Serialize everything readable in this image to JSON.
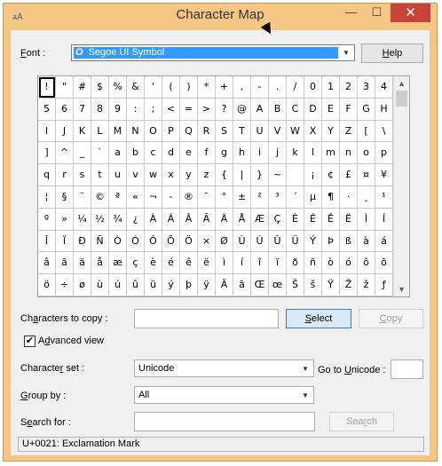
{
  "window": {
    "title": "Character Map",
    "icon": "charmap-app-icon",
    "minimize_glyph": "—",
    "maximize_glyph": "☐",
    "close_glyph": "✕"
  },
  "font": {
    "label_prefix": "",
    "label_key": "F",
    "label_rest": "ont :",
    "selected": "Segoe UI Symbol",
    "font_icon": "opentype-icon"
  },
  "help_button": {
    "key": "H",
    "rest": "elp"
  },
  "grid": {
    "selected_index": 0,
    "characters": [
      "!",
      "\"",
      "#",
      "$",
      "%",
      "&",
      "'",
      "(",
      ")",
      "*",
      "+",
      ",",
      "-",
      ".",
      "/",
      "0",
      "1",
      "2",
      "3",
      "4",
      "5",
      "6",
      "7",
      "8",
      "9",
      ":",
      ";",
      "<",
      "=",
      ">",
      "?",
      "@",
      "A",
      "B",
      "C",
      "D",
      "E",
      "F",
      "G",
      "H",
      "I",
      "J",
      "K",
      "L",
      "M",
      "N",
      "O",
      "P",
      "Q",
      "R",
      "S",
      "T",
      "U",
      "V",
      "W",
      "X",
      "Y",
      "Z",
      "[",
      "\\",
      "]",
      "^",
      "_",
      "`",
      "a",
      "b",
      "c",
      "d",
      "e",
      "f",
      "g",
      "h",
      "i",
      "j",
      "k",
      "l",
      "m",
      "n",
      "o",
      "p",
      "q",
      "r",
      "s",
      "t",
      "u",
      "v",
      "w",
      "x",
      "y",
      "z",
      "{",
      "|",
      "}",
      "~",
      " ",
      "¡",
      "¢",
      "£",
      "¤",
      "¥",
      "¦",
      "§",
      "¨",
      "©",
      "ª",
      "«",
      "¬",
      "-",
      "®",
      "¯",
      "°",
      "±",
      "²",
      "³",
      "´",
      "µ",
      "¶",
      "·",
      "¸",
      "¹",
      "º",
      "»",
      "¼",
      "½",
      "¾",
      "¿",
      "À",
      "Á",
      "Â",
      "Ã",
      "Ä",
      "Å",
      "Æ",
      "Ç",
      "È",
      "É",
      "Ê",
      "Ë",
      "Ì",
      "Í",
      "Î",
      "Ï",
      "Ð",
      "Ñ",
      "Ò",
      "Ó",
      "Ô",
      "Õ",
      "Ö",
      "×",
      "Ø",
      "Ù",
      "Ú",
      "Û",
      "Ü",
      "Ý",
      "Þ",
      "ß",
      "à",
      "á",
      "â",
      "ã",
      "ä",
      "å",
      "æ",
      "ç",
      "è",
      "é",
      "ê",
      "ë",
      "ì",
      "í",
      "î",
      "ï",
      "ð",
      "ñ",
      "ò",
      "ó",
      "ô",
      "õ",
      "ö",
      "÷",
      "ø",
      "ù",
      "ú",
      "û",
      "ü",
      "ý",
      "þ",
      "ÿ",
      "Ā",
      "ā",
      "Œ",
      "œ",
      "Š",
      "š",
      "Ÿ",
      "Ž",
      "ž",
      "ƒ"
    ],
    "scroll_up": "▲",
    "scroll_down": "▼"
  },
  "characters_to_copy": {
    "label_a": "Ch",
    "label_key": "a",
    "label_b": "racters to copy :",
    "value": ""
  },
  "select_button": {
    "key": "S",
    "rest": "elect"
  },
  "copy_button": {
    "key": "C",
    "rest": "opy"
  },
  "advanced_view": {
    "label_key": "d",
    "label_a": "A",
    "label_b": "vanced view",
    "checked": true,
    "check_glyph": "✔"
  },
  "character_set": {
    "label_a": "Characte",
    "label_key": "r",
    "label_b": " set :",
    "value": "Unicode"
  },
  "go_to_unicode": {
    "label_a": "Go to ",
    "label_key": "U",
    "label_b": "nicode :",
    "value": ""
  },
  "group_by": {
    "label_a": "",
    "label_key": "G",
    "label_b": "roup by :",
    "value": "All"
  },
  "search_for": {
    "label_a": "S",
    "label_key": "e",
    "label_b": "arch for :",
    "value": ""
  },
  "search_button": {
    "key": "r",
    "a": "Sea",
    "b": "ch"
  },
  "status_bar": "U+0021: Exclamation Mark",
  "colors": {
    "title_bar": "#f6c685",
    "close_button": "#c7433a",
    "selection": "#3399ff"
  }
}
